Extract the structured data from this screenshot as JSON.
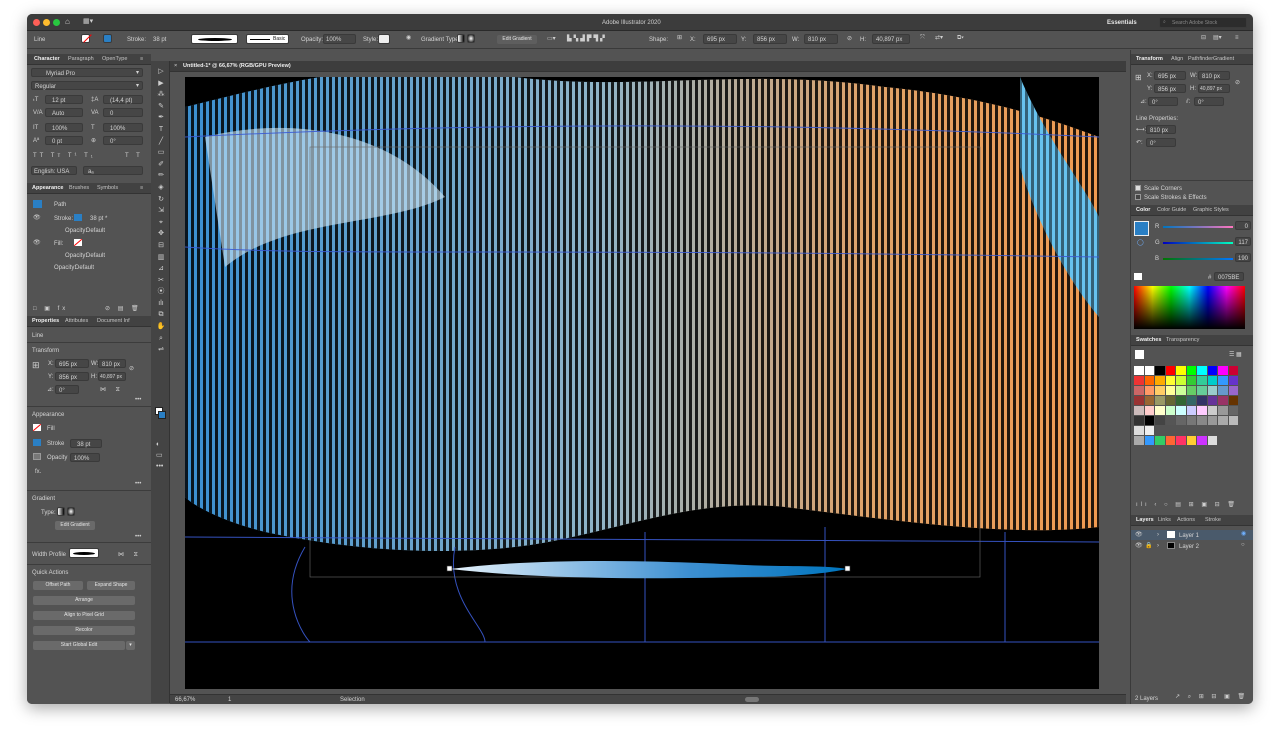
{
  "app": {
    "title": "Adobe Illustrator 2020",
    "workspace": "Essentials",
    "search_placeholder": "Search Adobe Stock"
  },
  "control_bar": {
    "selection_type": "Line",
    "stroke_label": "Stroke:",
    "stroke_value": "38 pt",
    "brush_label": "Basic",
    "opacity_label": "Opacity:",
    "opacity_value": "100%",
    "style_label": "Style:",
    "gradient_type_label": "Gradient Type:",
    "edit_gradient": "Edit Gradient",
    "shape_label": "Shape:",
    "x_label": "X:",
    "x_value": "695 px",
    "y_label": "Y:",
    "y_value": "856 px",
    "w_label": "W:",
    "w_value": "810 px",
    "h_label": "H:",
    "h_value": "40,897 px"
  },
  "document": {
    "tab_title": "Untitled-1* @ 66,67% (RGB/GPU Preview)"
  },
  "character_panel": {
    "tabs": [
      "Character",
      "Paragraph",
      "OpenType"
    ],
    "font": "Myriad Pro",
    "style": "Regular",
    "size": "12 pt",
    "leading": "(14,4 pt)",
    "kerning": "Auto",
    "tracking": "0",
    "vscale": "100%",
    "hscale": "100%",
    "baseline": "0 pt",
    "rotation": "0°",
    "language": "English: USA",
    "aa": "aₐ"
  },
  "appearance_panel": {
    "tabs": [
      "Appearance",
      "Brushes",
      "Symbols"
    ],
    "path": "Path",
    "stroke": "Stroke:",
    "stroke_value": "38 pt *",
    "opacity1": "Opacity:",
    "opacity1_value": "Default",
    "fill": "Fill:",
    "opacity2": "Opacity:",
    "opacity2_value": "Default",
    "opacity3": "Opacity:",
    "opacity3_value": "Default"
  },
  "properties_panel": {
    "tabs": [
      "Properties",
      "Attributes",
      "Document Inf"
    ],
    "object": "Line",
    "transform": "Transform",
    "x": "695 px",
    "w": "810 px",
    "y": "856 px",
    "h": "40,897 px",
    "angle": "0°",
    "appearance": "Appearance",
    "fill": "Fill",
    "stroke": "Stroke",
    "stroke_value": "38 pt",
    "opacity": "Opacity",
    "opacity_value": "100%",
    "fx": "fx.",
    "gradient": "Gradient",
    "type": "Type:",
    "edit_gradient": "Edit Gradient",
    "width_profile": "Width Profile",
    "quick_actions": "Quick Actions",
    "offset_path": "Offset Path",
    "expand_shape": "Expand Shape",
    "arrange": "Arrange",
    "align_pixel": "Align to Pixel Grid",
    "recolor": "Recolor",
    "start_global_edit": "Start Global Edit"
  },
  "transform_panel": {
    "tabs": [
      "Transform",
      "Align",
      "Pathfinder",
      "Gradient"
    ],
    "x": "695 px",
    "w": "810 px",
    "y": "856 px",
    "h": "40,897 px",
    "angle": "0°",
    "shear": "0°",
    "line_properties": "Line Properties:",
    "line_len": "810 px",
    "line_angle": "0°",
    "scale_corners": "Scale Corners",
    "scale_strokes": "Scale Strokes & Effects"
  },
  "color_panel": {
    "tabs": [
      "Color",
      "Color Guide",
      "Graphic Styles"
    ],
    "r": "0",
    "g": "117",
    "b": "190",
    "hex": "0075BE",
    "r_label": "R",
    "g_label": "G",
    "b_label": "B",
    "hash": "#"
  },
  "swatches_panel": {
    "tabs": [
      "Swatches",
      "Transparency"
    ]
  },
  "layers_panel": {
    "tabs": [
      "Layers",
      "Links",
      "Actions",
      "Stroke"
    ],
    "layers": [
      "Layer 1",
      "Layer 2"
    ],
    "count": "2 Layers"
  },
  "status": {
    "zoom": "66,67%",
    "artboard": "1",
    "tool": "Selection"
  },
  "colors": {
    "accent": "#0075BE"
  }
}
